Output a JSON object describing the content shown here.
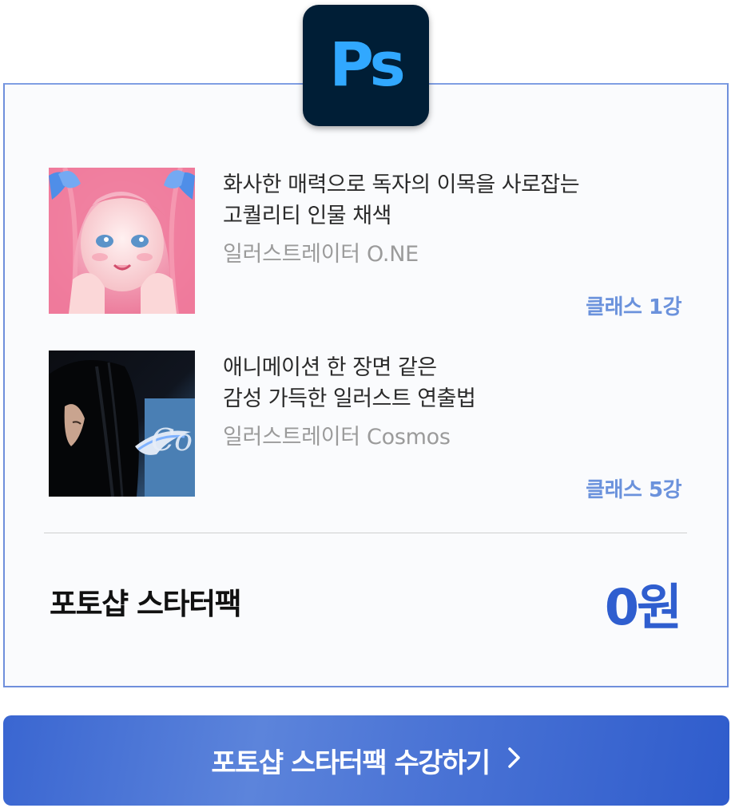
{
  "logo": {
    "text": "Ps",
    "icon": "photoshop-logo-icon"
  },
  "courses": [
    {
      "title_line1": "화사한 매력으로 독자의 이목을 사로잡는",
      "title_line2": "고퀄리티 인물 채색",
      "author": "일러스트레이터 O.NE",
      "count": "클래스 1강"
    },
    {
      "title_line1": "애니메이션 한 장면 같은",
      "title_line2": "감성 가득한 일러스트 연출법",
      "author": "일러스트레이터 Cosmos",
      "count": "클래스 5강"
    }
  ],
  "package": {
    "name": "포토샵 스타터팩",
    "price": "0원"
  },
  "cta": {
    "label": "포토샵 스타터팩 수강하기",
    "icon": "chevron-right-icon"
  },
  "colors": {
    "accent": "#2f5ecf",
    "count_text": "#6b92dc",
    "card_border": "#6f8fdc",
    "logo_bg": "#001e36",
    "logo_text": "#31a8ff"
  }
}
